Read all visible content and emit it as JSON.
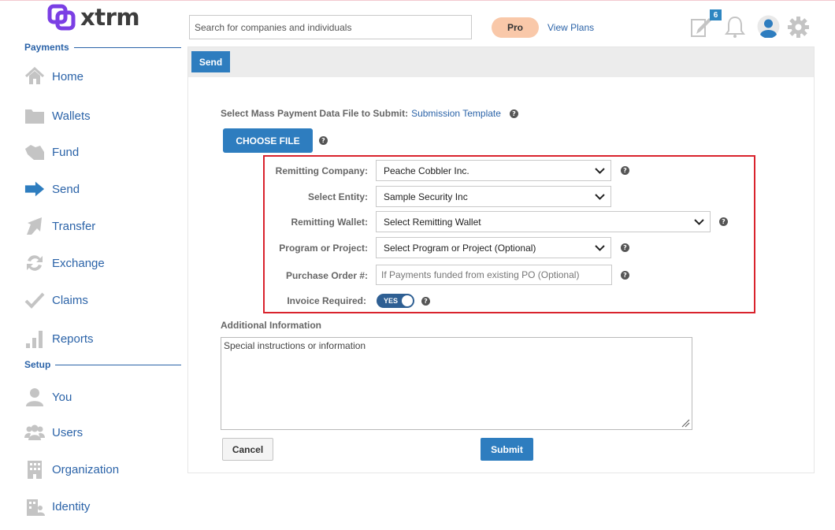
{
  "app": {
    "logo_text": "xtrm"
  },
  "sidebar": {
    "payments_heading": "Payments",
    "setup_heading": "Setup",
    "payments_items": [
      {
        "label": "Home",
        "icon": "home-icon"
      },
      {
        "label": "Wallets",
        "icon": "folder-icon"
      },
      {
        "label": "Fund",
        "icon": "fund-icon"
      },
      {
        "label": "Send",
        "icon": "send-arrow-icon"
      },
      {
        "label": "Transfer",
        "icon": "transfer-arrow-icon"
      },
      {
        "label": "Exchange",
        "icon": "exchange-icon"
      },
      {
        "label": "Claims",
        "icon": "checkmark-icon"
      },
      {
        "label": "Reports",
        "icon": "bar-chart-icon"
      }
    ],
    "setup_items": [
      {
        "label": "You",
        "icon": "user-icon"
      },
      {
        "label": "Users",
        "icon": "users-icon"
      },
      {
        "label": "Organization",
        "icon": "building-icon"
      },
      {
        "label": "Identity",
        "icon": "identity-icon"
      }
    ]
  },
  "topbar": {
    "search_placeholder": "Search for companies and individuals",
    "plan_badge": "Pro",
    "view_plans": "View Plans",
    "notification_count": "6"
  },
  "panel": {
    "tab_label": "Send",
    "file_prompt": "Select Mass Payment Data File to Submit:",
    "template_link": "Submission Template",
    "choose_file": "CHOOSE FILE"
  },
  "form": {
    "remitting_company": {
      "label": "Remitting Company:",
      "value": "Peache Cobbler Inc."
    },
    "select_entity": {
      "label": "Select Entity:",
      "value": "Sample Security Inc"
    },
    "remitting_wallet": {
      "label": "Remitting Wallet:",
      "value": "Select Remitting Wallet"
    },
    "program_project": {
      "label": "Program or Project:",
      "value": "Select Program or Project (Optional)"
    },
    "purchase_order": {
      "label": "Purchase Order #:",
      "placeholder": "If Payments funded from existing PO (Optional)"
    },
    "invoice_required": {
      "label": "Invoice Required:",
      "value": "YES"
    },
    "additional_info": {
      "label": "Additional Information",
      "placeholder": "Special instructions or information"
    },
    "cancel_label": "Cancel",
    "submit_label": "Submit"
  },
  "colors": {
    "accent": "#2e7dbf",
    "nav_text": "#2b63a8",
    "highlight_box": "#d9232d",
    "pro_badge": "#f9c8a9",
    "logo": "#7b3fe4"
  }
}
